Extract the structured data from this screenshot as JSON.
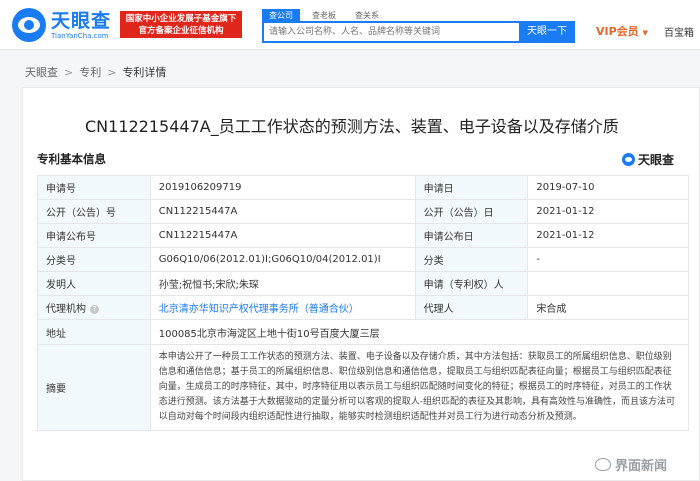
{
  "header": {
    "logo_cn": "天眼查",
    "logo_en": "TianYanCha.com",
    "badge_line1": "国家中小企业发展子基金旗下",
    "badge_line2": "官方备案企业征信机构",
    "tabs": [
      "查公司",
      "查老板",
      "查关系"
    ],
    "search_placeholder": "请输入公司名称、人名、品牌名称等关键词",
    "search_button": "天眼一下",
    "vip": "VIP会员",
    "vip_caret": "▼",
    "baoxiang": "百宝箱"
  },
  "breadcrumb": [
    "天眼查",
    "专利",
    "专利详情"
  ],
  "breadcrumb_sep": ">",
  "patent": {
    "title": "CN112215447A_员工工作状态的预测方法、装置、电子设备以及存储介质",
    "section_title": "专利基本信息",
    "watermark": "天眼查"
  },
  "table": {
    "row1": {
      "k1": "申请号",
      "v1": "2019106209719",
      "k2": "申请日",
      "v2": "2019-07-10"
    },
    "row2": {
      "k1": "公开（公告）号",
      "v1": "CN112215447A",
      "k2": "公开（公告）日",
      "v2": "2021-01-12"
    },
    "row3": {
      "k1": "申请公布号",
      "v1": "CN112215447A",
      "k2": "申请公布日",
      "v2": "2021-01-12"
    },
    "row4": {
      "k1": "分类号",
      "v1": "G06Q10/06(2012.01)I;G06Q10/04(2012.01)I",
      "k2": "分类",
      "v2": "-"
    },
    "row5": {
      "k1": "发明人",
      "v1": "孙莹;祝恒书;宋欣;朱琛",
      "k2": "申请（专利权）人",
      "v2": ""
    },
    "row6": {
      "k1": "代理机构",
      "v1": "北京清亦华知识产权代理事务所（普通合伙）",
      "k2": "代理人",
      "v2": "宋合成"
    },
    "row7": {
      "k1": "地址",
      "v1": "100085北京市海淀区上地十街10号百度大厦三层"
    },
    "row8": {
      "k1": "摘要",
      "v1": "本申请公开了一种员工工作状态的预测方法、装置、电子设备以及存储介质，其中方法包括：获取员工的所属组织信息、职位级别信息和通信信息；基于员工的所属组织信息、职位级别信息和通信信息，提取员工与组织匹配表征向量；根据员工与组织匹配表征向量，生成员工的时序特征，其中，时序特征用以表示员工与组织匹配随时间变化的特征；根据员工的时序特征，对员工的工作状态进行预测。该方法基于大数据驱动的定量分析可以客观的提取人-组织匹配的表征及其影响，具有高效性与准确性，而且该方法可以自动对每个时间段内组织适配性进行抽取，能够实时检测组织适配性并对员工行为进行动态分析及预测。"
    }
  },
  "bottom_watermark": "界面新闻"
}
